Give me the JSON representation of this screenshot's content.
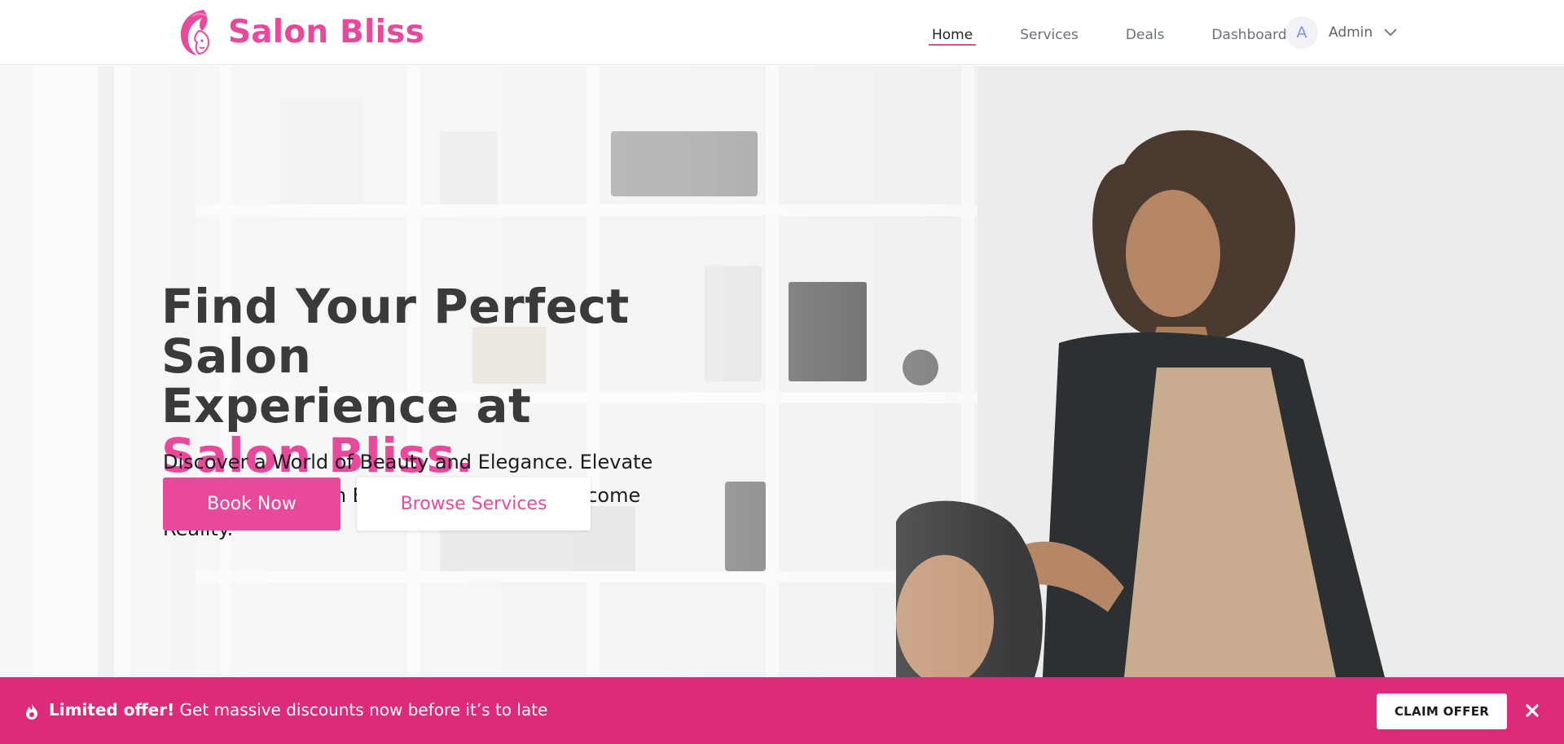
{
  "brand": {
    "name": "Salon Bliss",
    "logo_icon": "woman-face-logo-icon",
    "color": "#e8499a"
  },
  "nav": {
    "items": [
      {
        "label": "Home",
        "active": true
      },
      {
        "label": "Services",
        "active": false
      },
      {
        "label": "Deals",
        "active": false
      },
      {
        "label": "Dashboard",
        "active": false
      }
    ]
  },
  "user": {
    "avatar_initial": "A",
    "name": "Admin",
    "menu_icon": "chevron-down-icon"
  },
  "hero": {
    "title_line1": "Find Your Perfect Salon",
    "title_line2": "Experience at",
    "title_accent": "Salon Bliss.",
    "subtitle": "Discover a World of Beauty and Elegance. Elevate Your Style at Salon Bliss, Where Dreams Become Reality.",
    "primary_button": "Book Now",
    "secondary_button": "Browse Services",
    "image": "salon-stylist-with-client-photo"
  },
  "offer": {
    "icon": "fire-icon",
    "strong_text": "Limited offer!",
    "text": " Get massive discounts now before it’s to late",
    "button": "CLAIM OFFER",
    "close_icon": "close-icon",
    "background": "#dd2a7b"
  },
  "colors": {
    "accent": "#e8499a",
    "offer_bar": "#dd2a7b",
    "heading": "#3a3a3a"
  }
}
